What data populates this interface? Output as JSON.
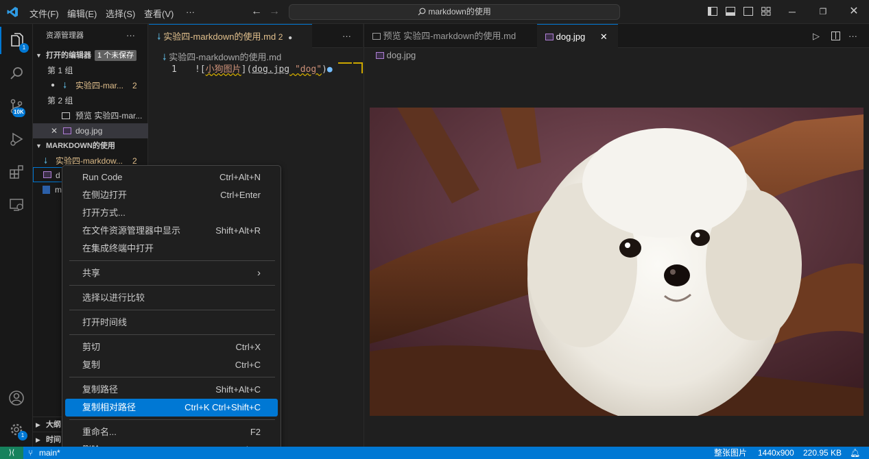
{
  "menu": {
    "file": "文件(F)",
    "edit": "编辑(E)",
    "select": "选择(S)",
    "view": "查看(V)",
    "more": "···"
  },
  "search": {
    "text": "markdown的使用"
  },
  "activity": {
    "explorer_badge": "1",
    "scm_badge": "10K",
    "settings_badge": "1"
  },
  "sidebar": {
    "title": "资源管理器",
    "more": "···",
    "open_editors": "打开的编辑器",
    "unsaved": "1 个未保存",
    "group1": "第 1 组",
    "group1_file": "实验四-mar...",
    "group1_badge": "2",
    "group2": "第 2 组",
    "group2_file1": "预览 实验四-mar...",
    "group2_file2": "dog.jpg",
    "folder": "MARKDOWN的使用",
    "folder_file1": "实验四-markdow...",
    "folder_file1_badge": "2",
    "folder_file2": "d",
    "folder_file3": "m",
    "outline": "大纲",
    "timeline": "时间"
  },
  "editor1": {
    "tab": "实验四-markdown的使用.md",
    "tab_badge": "2",
    "crumb": "实验四-markdown的使用.md",
    "line_no": "1",
    "code_pre": "![",
    "code_alt": "小狗图片",
    "code_mid": "](",
    "code_file": "dog.jpg",
    "code_title": " \"dog\"",
    "code_end": ")"
  },
  "editor2": {
    "tab1": "预览 实验四-markdown的使用.md",
    "tab2": "dog.jpg",
    "crumb": "dog.jpg"
  },
  "context_menu": [
    {
      "label": "Run Code",
      "key": "Ctrl+Alt+N"
    },
    {
      "label": "在侧边打开",
      "key": "Ctrl+Enter"
    },
    {
      "label": "打开方式...",
      "key": ""
    },
    {
      "label": "在文件资源管理器中显示",
      "key": "Shift+Alt+R"
    },
    {
      "label": "在集成终端中打开",
      "key": ""
    },
    {
      "label": "共享",
      "key": ""
    },
    {
      "label": "选择以进行比较",
      "key": ""
    },
    {
      "label": "打开时间线",
      "key": ""
    },
    {
      "label": "剪切",
      "key": "Ctrl+X"
    },
    {
      "label": "复制",
      "key": "Ctrl+C"
    },
    {
      "label": "复制路径",
      "key": "Shift+Alt+C"
    },
    {
      "label": "复制相对路径",
      "key": "Ctrl+K Ctrl+Shift+C"
    },
    {
      "label": "重命名...",
      "key": "F2"
    },
    {
      "label": "删除",
      "key": "Delete"
    }
  ],
  "status": {
    "branch": "main*",
    "image_mode": "整张图片",
    "dimensions": "1440x900",
    "size": "220.95 KB"
  },
  "colors": {
    "accent": "#0078d4",
    "modified": "#e2c08d"
  }
}
